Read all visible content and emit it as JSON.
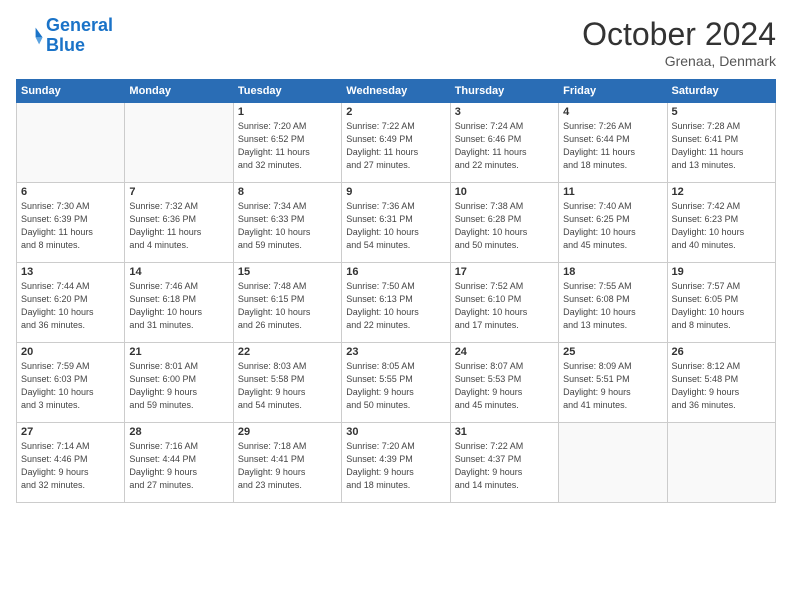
{
  "header": {
    "logo_line1": "General",
    "logo_line2": "Blue",
    "month": "October 2024",
    "location": "Grenaa, Denmark"
  },
  "days_of_week": [
    "Sunday",
    "Monday",
    "Tuesday",
    "Wednesday",
    "Thursday",
    "Friday",
    "Saturday"
  ],
  "weeks": [
    [
      {
        "day": "",
        "info": ""
      },
      {
        "day": "",
        "info": ""
      },
      {
        "day": "1",
        "info": "Sunrise: 7:20 AM\nSunset: 6:52 PM\nDaylight: 11 hours\nand 32 minutes."
      },
      {
        "day": "2",
        "info": "Sunrise: 7:22 AM\nSunset: 6:49 PM\nDaylight: 11 hours\nand 27 minutes."
      },
      {
        "day": "3",
        "info": "Sunrise: 7:24 AM\nSunset: 6:46 PM\nDaylight: 11 hours\nand 22 minutes."
      },
      {
        "day": "4",
        "info": "Sunrise: 7:26 AM\nSunset: 6:44 PM\nDaylight: 11 hours\nand 18 minutes."
      },
      {
        "day": "5",
        "info": "Sunrise: 7:28 AM\nSunset: 6:41 PM\nDaylight: 11 hours\nand 13 minutes."
      }
    ],
    [
      {
        "day": "6",
        "info": "Sunrise: 7:30 AM\nSunset: 6:39 PM\nDaylight: 11 hours\nand 8 minutes."
      },
      {
        "day": "7",
        "info": "Sunrise: 7:32 AM\nSunset: 6:36 PM\nDaylight: 11 hours\nand 4 minutes."
      },
      {
        "day": "8",
        "info": "Sunrise: 7:34 AM\nSunset: 6:33 PM\nDaylight: 10 hours\nand 59 minutes."
      },
      {
        "day": "9",
        "info": "Sunrise: 7:36 AM\nSunset: 6:31 PM\nDaylight: 10 hours\nand 54 minutes."
      },
      {
        "day": "10",
        "info": "Sunrise: 7:38 AM\nSunset: 6:28 PM\nDaylight: 10 hours\nand 50 minutes."
      },
      {
        "day": "11",
        "info": "Sunrise: 7:40 AM\nSunset: 6:25 PM\nDaylight: 10 hours\nand 45 minutes."
      },
      {
        "day": "12",
        "info": "Sunrise: 7:42 AM\nSunset: 6:23 PM\nDaylight: 10 hours\nand 40 minutes."
      }
    ],
    [
      {
        "day": "13",
        "info": "Sunrise: 7:44 AM\nSunset: 6:20 PM\nDaylight: 10 hours\nand 36 minutes."
      },
      {
        "day": "14",
        "info": "Sunrise: 7:46 AM\nSunset: 6:18 PM\nDaylight: 10 hours\nand 31 minutes."
      },
      {
        "day": "15",
        "info": "Sunrise: 7:48 AM\nSunset: 6:15 PM\nDaylight: 10 hours\nand 26 minutes."
      },
      {
        "day": "16",
        "info": "Sunrise: 7:50 AM\nSunset: 6:13 PM\nDaylight: 10 hours\nand 22 minutes."
      },
      {
        "day": "17",
        "info": "Sunrise: 7:52 AM\nSunset: 6:10 PM\nDaylight: 10 hours\nand 17 minutes."
      },
      {
        "day": "18",
        "info": "Sunrise: 7:55 AM\nSunset: 6:08 PM\nDaylight: 10 hours\nand 13 minutes."
      },
      {
        "day": "19",
        "info": "Sunrise: 7:57 AM\nSunset: 6:05 PM\nDaylight: 10 hours\nand 8 minutes."
      }
    ],
    [
      {
        "day": "20",
        "info": "Sunrise: 7:59 AM\nSunset: 6:03 PM\nDaylight: 10 hours\nand 3 minutes."
      },
      {
        "day": "21",
        "info": "Sunrise: 8:01 AM\nSunset: 6:00 PM\nDaylight: 9 hours\nand 59 minutes."
      },
      {
        "day": "22",
        "info": "Sunrise: 8:03 AM\nSunset: 5:58 PM\nDaylight: 9 hours\nand 54 minutes."
      },
      {
        "day": "23",
        "info": "Sunrise: 8:05 AM\nSunset: 5:55 PM\nDaylight: 9 hours\nand 50 minutes."
      },
      {
        "day": "24",
        "info": "Sunrise: 8:07 AM\nSunset: 5:53 PM\nDaylight: 9 hours\nand 45 minutes."
      },
      {
        "day": "25",
        "info": "Sunrise: 8:09 AM\nSunset: 5:51 PM\nDaylight: 9 hours\nand 41 minutes."
      },
      {
        "day": "26",
        "info": "Sunrise: 8:12 AM\nSunset: 5:48 PM\nDaylight: 9 hours\nand 36 minutes."
      }
    ],
    [
      {
        "day": "27",
        "info": "Sunrise: 7:14 AM\nSunset: 4:46 PM\nDaylight: 9 hours\nand 32 minutes."
      },
      {
        "day": "28",
        "info": "Sunrise: 7:16 AM\nSunset: 4:44 PM\nDaylight: 9 hours\nand 27 minutes."
      },
      {
        "day": "29",
        "info": "Sunrise: 7:18 AM\nSunset: 4:41 PM\nDaylight: 9 hours\nand 23 minutes."
      },
      {
        "day": "30",
        "info": "Sunrise: 7:20 AM\nSunset: 4:39 PM\nDaylight: 9 hours\nand 18 minutes."
      },
      {
        "day": "31",
        "info": "Sunrise: 7:22 AM\nSunset: 4:37 PM\nDaylight: 9 hours\nand 14 minutes."
      },
      {
        "day": "",
        "info": ""
      },
      {
        "day": "",
        "info": ""
      }
    ]
  ]
}
